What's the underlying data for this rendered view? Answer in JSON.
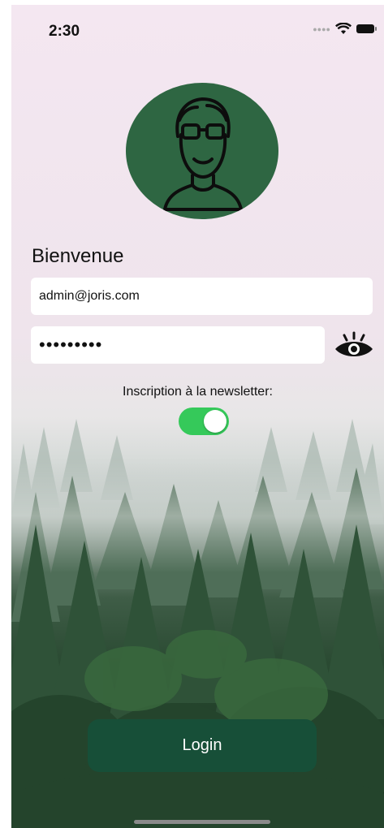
{
  "status_bar": {
    "time": "2:30",
    "signal_icon": "signal-dots-icon",
    "wifi_icon": "wifi-icon",
    "battery_icon": "battery-icon"
  },
  "avatar": {
    "icon": "user-avatar-icon",
    "background_color": "#2e6642"
  },
  "login_form": {
    "welcome_title": "Bienvenue",
    "email_value": "admin@joris.com",
    "password_value": "•••••••••",
    "show_password_icon": "eye-icon",
    "newsletter_label": "Inscription à la newsletter:",
    "newsletter_toggle_on": true,
    "toggle_color": "#35c95a",
    "login_label": "Login",
    "login_color": "#174f38"
  }
}
